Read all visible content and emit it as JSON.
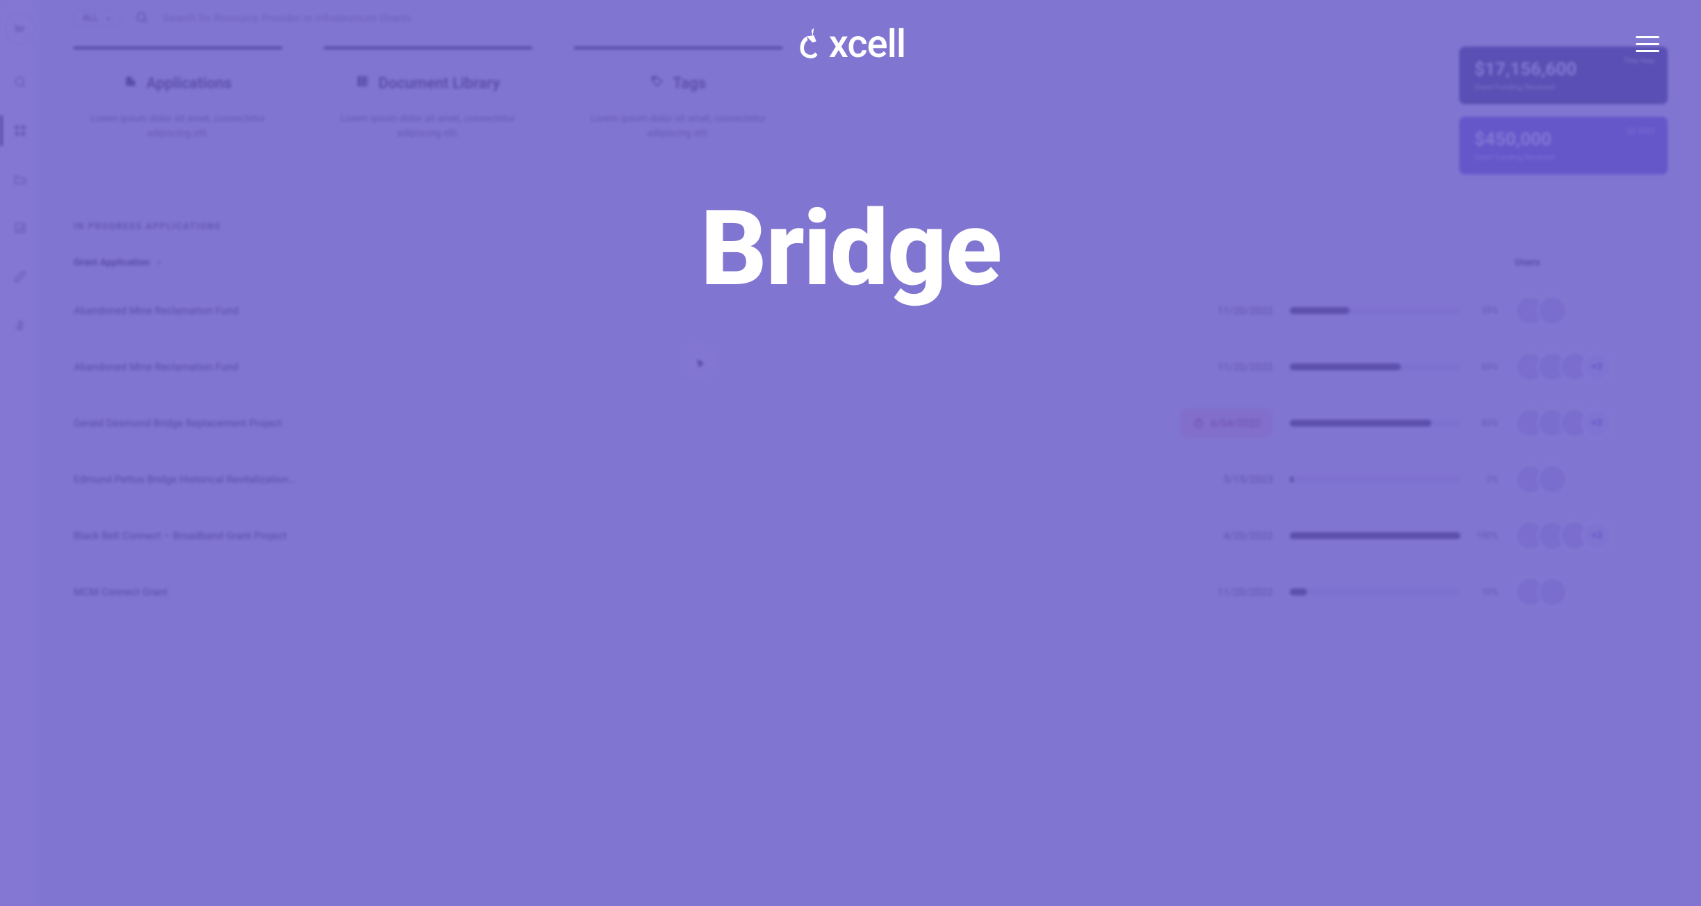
{
  "overlay": {
    "brand": "xcell",
    "hero": "Bridge"
  },
  "sidebar": {
    "logo_text": "br"
  },
  "topbar": {
    "filter_label": "ALL",
    "search_placeholder": "Search for Resource Provider or Infrastructure Grants"
  },
  "cards": [
    {
      "title": "Applications",
      "desc": "Lorem ipsum dolor sit amet, consectetur adipiscing elit."
    },
    {
      "title": "Document Library",
      "desc": "Lorem ipsum dolor sit amet, consectetur adipiscing elit."
    },
    {
      "title": "Tags",
      "desc": "Lorem ipsum dolor sit amet, consectetur adipiscing elit."
    }
  ],
  "stats": {
    "primary": {
      "amount": "$17,156,600",
      "caption": "Grant Funding Received",
      "period": "This Year"
    },
    "secondary": {
      "amount": "$450,000",
      "caption": "Grant Funding Received",
      "period": "Q2 2022"
    }
  },
  "section_title": "IN PROGRESS APPLICATIONS",
  "table": {
    "head": {
      "name": "Grant Application",
      "date": "",
      "progress": "",
      "users": "Users"
    },
    "rows": [
      {
        "name": "Abandoned Mine Reclamation Fund",
        "date": "11/20/2022",
        "overdue": false,
        "pct": 35,
        "extra_users": 0
      },
      {
        "name": "Abandoned Mine Reclamation Fund",
        "date": "11/20/2022",
        "overdue": false,
        "pct": 65,
        "extra_users": 3
      },
      {
        "name": "Gerald Desmond Bridge Replacement Project",
        "date": "6/04/2022",
        "overdue": true,
        "pct": 83,
        "extra_users": 3
      },
      {
        "name": "Edmund Pettus Bridge Historical Revitalization…",
        "date": "5/15/2023",
        "overdue": false,
        "pct": 2,
        "extra_users": 0
      },
      {
        "name": "Black Belt Connect – Broadband Grant Project",
        "date": "4/20/2022",
        "overdue": false,
        "pct": 100,
        "extra_users": 3
      },
      {
        "name": "MCM Connect Grant",
        "date": "11/20/2022",
        "overdue": false,
        "pct": 10,
        "extra_users": 0
      }
    ]
  }
}
